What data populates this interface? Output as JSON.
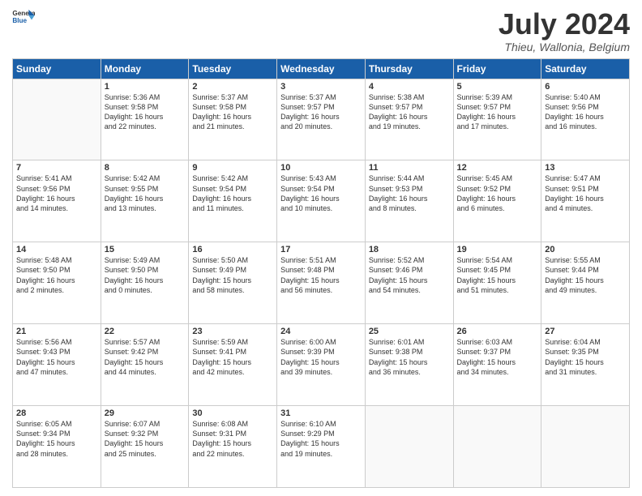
{
  "header": {
    "logo_general": "General",
    "logo_blue": "Blue",
    "title": "July 2024",
    "location": "Thieu, Wallonia, Belgium"
  },
  "weekdays": [
    "Sunday",
    "Monday",
    "Tuesday",
    "Wednesday",
    "Thursday",
    "Friday",
    "Saturday"
  ],
  "weeks": [
    [
      {
        "day": "",
        "sunrise": "",
        "sunset": "",
        "daylight": ""
      },
      {
        "day": "1",
        "sunrise": "Sunrise: 5:36 AM",
        "sunset": "Sunset: 9:58 PM",
        "daylight": "Daylight: 16 hours and 22 minutes."
      },
      {
        "day": "2",
        "sunrise": "Sunrise: 5:37 AM",
        "sunset": "Sunset: 9:58 PM",
        "daylight": "Daylight: 16 hours and 21 minutes."
      },
      {
        "day": "3",
        "sunrise": "Sunrise: 5:37 AM",
        "sunset": "Sunset: 9:57 PM",
        "daylight": "Daylight: 16 hours and 20 minutes."
      },
      {
        "day": "4",
        "sunrise": "Sunrise: 5:38 AM",
        "sunset": "Sunset: 9:57 PM",
        "daylight": "Daylight: 16 hours and 19 minutes."
      },
      {
        "day": "5",
        "sunrise": "Sunrise: 5:39 AM",
        "sunset": "Sunset: 9:57 PM",
        "daylight": "Daylight: 16 hours and 17 minutes."
      },
      {
        "day": "6",
        "sunrise": "Sunrise: 5:40 AM",
        "sunset": "Sunset: 9:56 PM",
        "daylight": "Daylight: 16 hours and 16 minutes."
      }
    ],
    [
      {
        "day": "7",
        "sunrise": "Sunrise: 5:41 AM",
        "sunset": "Sunset: 9:56 PM",
        "daylight": "Daylight: 16 hours and 14 minutes."
      },
      {
        "day": "8",
        "sunrise": "Sunrise: 5:42 AM",
        "sunset": "Sunset: 9:55 PM",
        "daylight": "Daylight: 16 hours and 13 minutes."
      },
      {
        "day": "9",
        "sunrise": "Sunrise: 5:42 AM",
        "sunset": "Sunset: 9:54 PM",
        "daylight": "Daylight: 16 hours and 11 minutes."
      },
      {
        "day": "10",
        "sunrise": "Sunrise: 5:43 AM",
        "sunset": "Sunset: 9:54 PM",
        "daylight": "Daylight: 16 hours and 10 minutes."
      },
      {
        "day": "11",
        "sunrise": "Sunrise: 5:44 AM",
        "sunset": "Sunset: 9:53 PM",
        "daylight": "Daylight: 16 hours and 8 minutes."
      },
      {
        "day": "12",
        "sunrise": "Sunrise: 5:45 AM",
        "sunset": "Sunset: 9:52 PM",
        "daylight": "Daylight: 16 hours and 6 minutes."
      },
      {
        "day": "13",
        "sunrise": "Sunrise: 5:47 AM",
        "sunset": "Sunset: 9:51 PM",
        "daylight": "Daylight: 16 hours and 4 minutes."
      }
    ],
    [
      {
        "day": "14",
        "sunrise": "Sunrise: 5:48 AM",
        "sunset": "Sunset: 9:50 PM",
        "daylight": "Daylight: 16 hours and 2 minutes."
      },
      {
        "day": "15",
        "sunrise": "Sunrise: 5:49 AM",
        "sunset": "Sunset: 9:50 PM",
        "daylight": "Daylight: 16 hours and 0 minutes."
      },
      {
        "day": "16",
        "sunrise": "Sunrise: 5:50 AM",
        "sunset": "Sunset: 9:49 PM",
        "daylight": "Daylight: 15 hours and 58 minutes."
      },
      {
        "day": "17",
        "sunrise": "Sunrise: 5:51 AM",
        "sunset": "Sunset: 9:48 PM",
        "daylight": "Daylight: 15 hours and 56 minutes."
      },
      {
        "day": "18",
        "sunrise": "Sunrise: 5:52 AM",
        "sunset": "Sunset: 9:46 PM",
        "daylight": "Daylight: 15 hours and 54 minutes."
      },
      {
        "day": "19",
        "sunrise": "Sunrise: 5:54 AM",
        "sunset": "Sunset: 9:45 PM",
        "daylight": "Daylight: 15 hours and 51 minutes."
      },
      {
        "day": "20",
        "sunrise": "Sunrise: 5:55 AM",
        "sunset": "Sunset: 9:44 PM",
        "daylight": "Daylight: 15 hours and 49 minutes."
      }
    ],
    [
      {
        "day": "21",
        "sunrise": "Sunrise: 5:56 AM",
        "sunset": "Sunset: 9:43 PM",
        "daylight": "Daylight: 15 hours and 47 minutes."
      },
      {
        "day": "22",
        "sunrise": "Sunrise: 5:57 AM",
        "sunset": "Sunset: 9:42 PM",
        "daylight": "Daylight: 15 hours and 44 minutes."
      },
      {
        "day": "23",
        "sunrise": "Sunrise: 5:59 AM",
        "sunset": "Sunset: 9:41 PM",
        "daylight": "Daylight: 15 hours and 42 minutes."
      },
      {
        "day": "24",
        "sunrise": "Sunrise: 6:00 AM",
        "sunset": "Sunset: 9:39 PM",
        "daylight": "Daylight: 15 hours and 39 minutes."
      },
      {
        "day": "25",
        "sunrise": "Sunrise: 6:01 AM",
        "sunset": "Sunset: 9:38 PM",
        "daylight": "Daylight: 15 hours and 36 minutes."
      },
      {
        "day": "26",
        "sunrise": "Sunrise: 6:03 AM",
        "sunset": "Sunset: 9:37 PM",
        "daylight": "Daylight: 15 hours and 34 minutes."
      },
      {
        "day": "27",
        "sunrise": "Sunrise: 6:04 AM",
        "sunset": "Sunset: 9:35 PM",
        "daylight": "Daylight: 15 hours and 31 minutes."
      }
    ],
    [
      {
        "day": "28",
        "sunrise": "Sunrise: 6:05 AM",
        "sunset": "Sunset: 9:34 PM",
        "daylight": "Daylight: 15 hours and 28 minutes."
      },
      {
        "day": "29",
        "sunrise": "Sunrise: 6:07 AM",
        "sunset": "Sunset: 9:32 PM",
        "daylight": "Daylight: 15 hours and 25 minutes."
      },
      {
        "day": "30",
        "sunrise": "Sunrise: 6:08 AM",
        "sunset": "Sunset: 9:31 PM",
        "daylight": "Daylight: 15 hours and 22 minutes."
      },
      {
        "day": "31",
        "sunrise": "Sunrise: 6:10 AM",
        "sunset": "Sunset: 9:29 PM",
        "daylight": "Daylight: 15 hours and 19 minutes."
      },
      {
        "day": "",
        "sunrise": "",
        "sunset": "",
        "daylight": ""
      },
      {
        "day": "",
        "sunrise": "",
        "sunset": "",
        "daylight": ""
      },
      {
        "day": "",
        "sunrise": "",
        "sunset": "",
        "daylight": ""
      }
    ]
  ]
}
